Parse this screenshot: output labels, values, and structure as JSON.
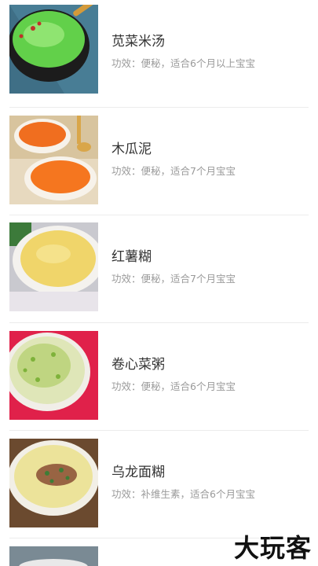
{
  "recipes": [
    {
      "name": "苋菜米汤",
      "effect": "功效：便秘，适合6个月以上宝宝",
      "image": "green-rice-soup"
    },
    {
      "name": "木瓜泥",
      "effect": "功效：便秘，适合7个月宝宝",
      "image": "papaya-puree"
    },
    {
      "name": "红薯糊",
      "effect": "功效：便秘，适合7个月宝宝",
      "image": "sweet-potato-paste"
    },
    {
      "name": "卷心菜粥",
      "effect": "功效：便秘，适合6个月宝宝",
      "image": "cabbage-porridge"
    },
    {
      "name": "乌龙面糊",
      "effect": "功效：补维生素，适合6个月宝宝",
      "image": "noodle-paste"
    }
  ],
  "watermark": "大玩客"
}
